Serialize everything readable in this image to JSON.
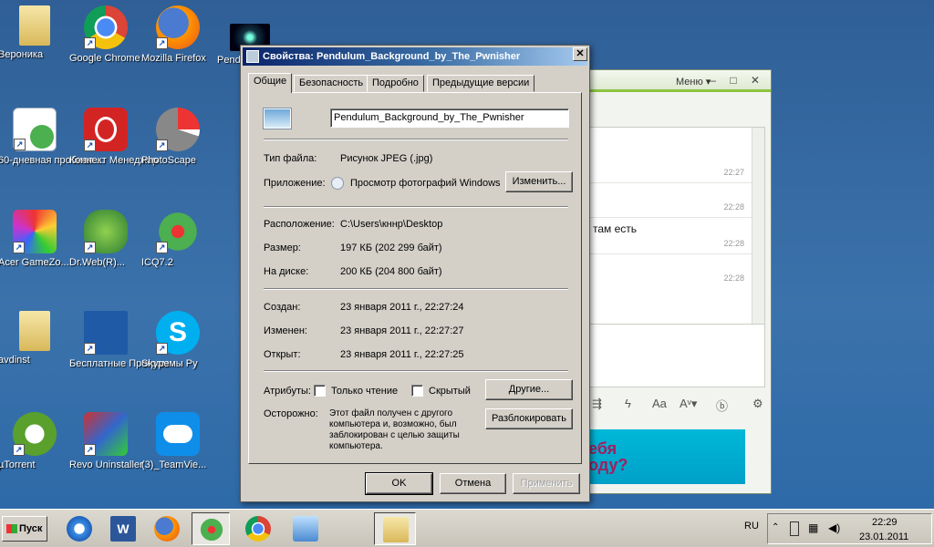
{
  "desktop": {
    "icons": [
      {
        "label": "Вероника",
        "icon": "folder-icon",
        "shortcut": false
      },
      {
        "label": "Google Chrome",
        "icon": "chrome-icon",
        "shortcut": true
      },
      {
        "label": "Mozilla Firefox",
        "icon": "firefox-icon",
        "shortcut": true
      },
      {
        "label": "Pendu",
        "icon": "image-file-icon",
        "shortcut": false
      },
      {
        "label": "60-дневная пробная ...",
        "icon": "office-trial-icon",
        "shortcut": true
      },
      {
        "label": "Коннект Менеджер",
        "icon": "connect-manager-icon",
        "shortcut": true
      },
      {
        "label": "PhotoScape",
        "icon": "photoscape-icon",
        "shortcut": true
      },
      {
        "label": "Acer GameZo...",
        "icon": "acer-gamezone-icon",
        "shortcut": true
      },
      {
        "label": "Dr.Web(R)...",
        "icon": "drweb-icon",
        "shortcut": true
      },
      {
        "label": "ICQ7.2",
        "icon": "icq-icon",
        "shortcut": true
      },
      {
        "label": "avdinst",
        "icon": "folder-icon",
        "shortcut": false
      },
      {
        "label": "Бесплатные Программы Ру",
        "icon": "freeprograms-icon",
        "shortcut": true
      },
      {
        "label": "Skype",
        "icon": "skype-icon",
        "shortcut": true
      },
      {
        "label": "µTorrent",
        "icon": "utorrent-icon",
        "shortcut": true
      },
      {
        "label": "Revo Uninstaller",
        "icon": "revo-uninstaller-icon",
        "shortcut": true
      },
      {
        "label": "(3)_TeamVie...",
        "icon": "teamviewer-icon",
        "shortcut": false
      }
    ]
  },
  "chat": {
    "menu_label": "Меню ▾",
    "window_controls": "– □ ✕",
    "times": [
      "22:27",
      "22:28",
      "22:28",
      "22:28"
    ],
    "partial_message": "о там есть",
    "banner_text": "ебя\nоду?"
  },
  "dialog": {
    "title": "Свойства: Pendulum_Background_by_The_Pwnisher",
    "close_label": "✕",
    "tabs": [
      "Общие",
      "Безопасность",
      "Подробно",
      "Предыдущие версии"
    ],
    "active_tab": "Общие",
    "file_name": "Pendulum_Background_by_The_Pwnisher",
    "file_type_label": "Тип файла:",
    "file_type_value": "Рисунок JPEG (.jpg)",
    "app_label": "Приложение:",
    "app_value": "Просмотр фотографий Windows",
    "change_button": "Изменить...",
    "location_label": "Расположение:",
    "location_value": "C:\\Users\\кннр\\Desktop",
    "size_label": "Размер:",
    "size_value": "197 КБ (202 299 байт)",
    "disk_label": "На диске:",
    "disk_value": "200 КБ (204 800 байт)",
    "created_label": "Создан:",
    "created_value": "23 января 2011 г., 22:27:24",
    "modified_label": "Изменен:",
    "modified_value": "23 января 2011 г., 22:27:27",
    "opened_label": "Открыт:",
    "opened_value": "23 января 2011 г., 22:27:25",
    "attributes_label": "Атрибуты:",
    "readonly_label": "Только чтение",
    "hidden_label": "Скрытый",
    "other_button": "Другие...",
    "caution_label": "Осторожно:",
    "caution_text": "Этот файл получен с другого компьютера и, возможно, был заблокирован с целью защиты компьютера.",
    "unblock_button": "Разблокировать",
    "ok_button": "OK",
    "cancel_button": "Отмена",
    "apply_button": "Применить"
  },
  "taskbar": {
    "start_label": "Пуск",
    "pinned": [
      "internet-explorer-icon",
      "word-icon",
      "firefox-icon",
      "icq-icon",
      "chrome-icon",
      "control-panel-icon",
      "explorer-folder-icon"
    ],
    "language": "RU",
    "clock_time": "22:29",
    "clock_date": "23.01.2011"
  }
}
